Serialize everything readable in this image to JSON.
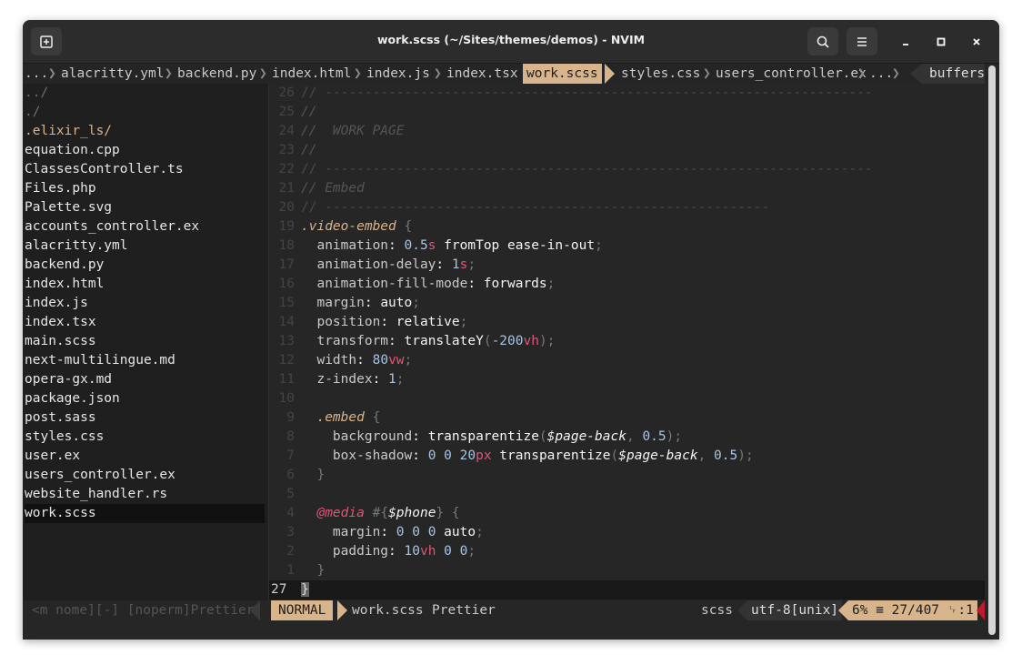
{
  "window": {
    "title": "work.scss (~/Sites/themes/demos) - NVIM"
  },
  "icons": {
    "new_tab": "new-tab-icon",
    "search": "search-icon",
    "menu": "hamburger-menu-icon",
    "minimize": "minimize-icon",
    "maximize": "maximize-icon",
    "close": "close-icon"
  },
  "colors": {
    "accent": "#d8b48c",
    "background": "#262626",
    "sidebar": "#1f1f1f",
    "error": "#e0557a"
  },
  "tabline": {
    "leading": "...",
    "tabs": [
      "alacritty.yml",
      "backend.py",
      "index.html",
      "index.js",
      "index.tsx",
      "work.scss",
      "styles.css",
      "users_controller.ex"
    ],
    "trailing": "...",
    "more": "...",
    "active": "work.scss",
    "buffers_label": "buffers"
  },
  "file_tree": {
    "entries": [
      "../",
      "./",
      ".elixir_ls/",
      "equation.cpp",
      "ClassesController.ts",
      "Files.php",
      "Palette.svg",
      "accounts_controller.ex",
      "alacritty.yml",
      "backend.py",
      "index.html",
      "index.js",
      "index.tsx",
      "main.scss",
      "next-multilingue.md",
      "opera-gx.md",
      "package.json",
      "post.sass",
      "styles.css",
      "user.ex",
      "users_controller.ex",
      "website_handler.rs",
      "work.scss"
    ],
    "selected": "work.scss"
  },
  "editor": {
    "line_numbers": [
      "26",
      "25",
      "24",
      "23",
      "22",
      "21",
      "20",
      "19",
      "18",
      "17",
      "16",
      "15",
      "14",
      "13",
      "12",
      "11",
      "10",
      "9",
      "8",
      "7",
      "6",
      "5",
      "4",
      "3",
      "2",
      "1",
      "27"
    ],
    "comment_rule": "// ---------------------------------------------------------------------",
    "comment_rule_short": "// --------------------------------------------------------",
    "comment_blank": "//",
    "comment_work_page": "//  WORK PAGE",
    "comment_embed": "// Embed",
    "selector": ".video-embed",
    "nested_selector": ".embed",
    "media_rule": "@media",
    "media_var": "$phone",
    "page_back_var": "$page-back",
    "fn_transparentize": "transparentize",
    "fn_translate": "translateY"
  },
  "statusline": {
    "left_inactive": "<m nome][-] [noperm]Prettier",
    "mode": "NORMAL",
    "filename": "work.scss",
    "formatter": "Prettier",
    "filetype": "scss",
    "encoding": "utf-8[unix]",
    "position": "6% ≡ 27/407 ␊:1"
  }
}
